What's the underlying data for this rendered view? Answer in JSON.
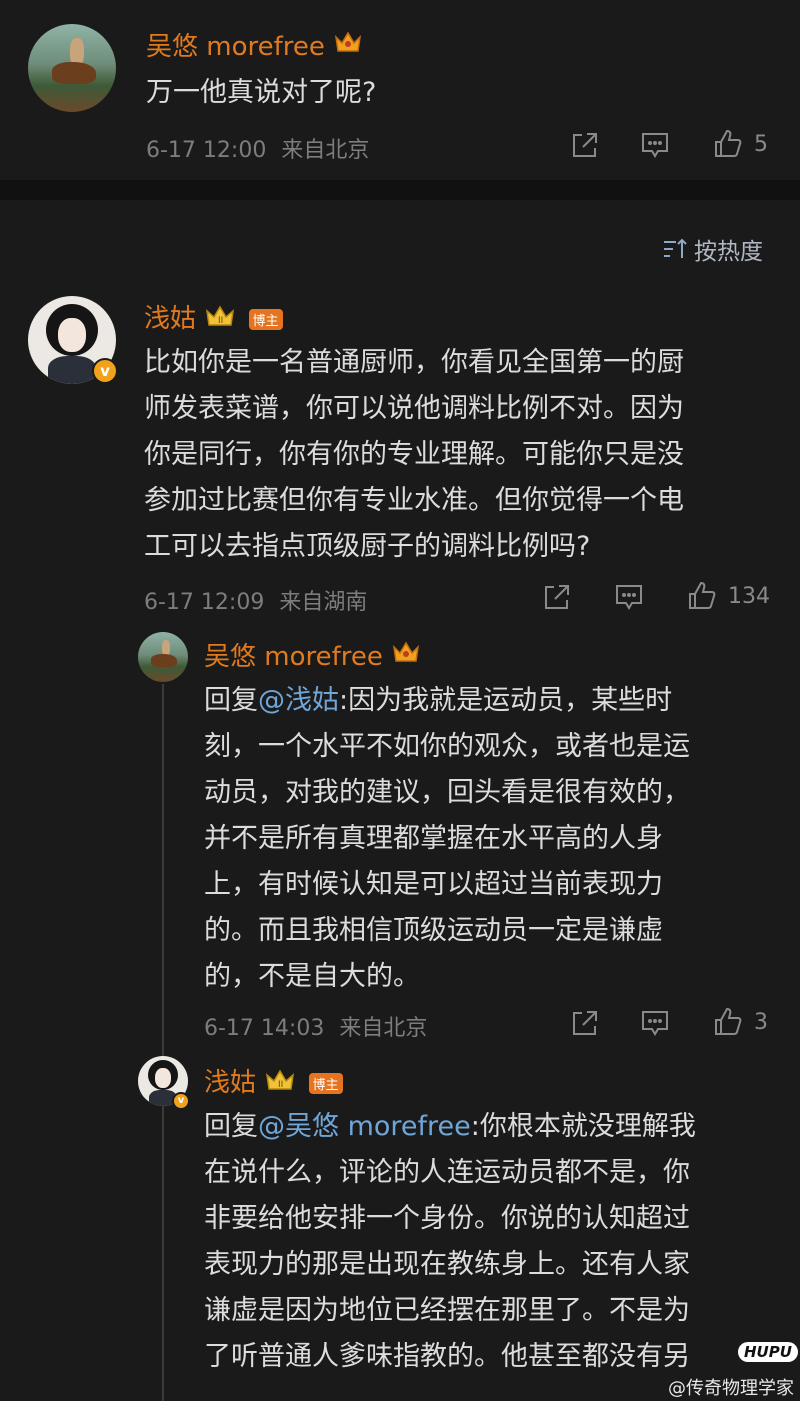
{
  "top_comment": {
    "username": "吴悠 morefree",
    "text": "万一他真说对了呢?",
    "time": "6-17 12:00",
    "location": "来自北京",
    "likes": "5"
  },
  "sort": {
    "label": "按热度"
  },
  "main_comment": {
    "username": "浅姑",
    "badge": "博主",
    "lines": [
      "比如你是一名普通厨师，你看见全国第一的厨",
      "师发表菜谱，你可以说他调料比例不对。因为",
      "你是同行，你有你的专业理解。可能你只是没",
      "参加过比赛但你有专业水准。但你觉得一个电",
      "工可以去指点顶级厨子的调料比例吗?"
    ],
    "time": "6-17 12:09",
    "location": "来自湖南",
    "likes": "134"
  },
  "reply1": {
    "username": "吴悠 morefree",
    "prefix": "回复",
    "mention": "@浅姑",
    "lines": [
      ":因为我就是运动员，某些时",
      "刻，一个水平不如你的观众，或者也是运",
      "动员，对我的建议，回头看是很有效的，",
      "并不是所有真理都掌握在水平高的人身",
      "上，有时候认知是可以超过当前表现力",
      "的。而且我相信顶级运动员一定是谦虚",
      "的，不是自大的。"
    ],
    "time": "6-17 14:03",
    "location": "来自北京",
    "likes": "3"
  },
  "reply2": {
    "username": "浅姑",
    "badge": "博主",
    "prefix": "回复",
    "mention": "@吴悠 morefree",
    "lines": [
      ":你根本就没理解我",
      "在说什么，评论的人连运动员都不是，你",
      "非要给他安排一个身份。你说的认知超过",
      "表现力的那是出现在教练身上。还有人家",
      "谦虚是因为地位已经摆在那里了。不是为",
      "了听普通人爹味指教的。他甚至都没有另"
    ]
  },
  "watermark": {
    "logo": "HUPU",
    "text": "@传奇物理学家"
  },
  "colors": {
    "background": "#1a1a1a",
    "username": "#e07a1f",
    "mention": "#6fa6d8",
    "meta": "#7d7d7d",
    "badge": "#e6731f"
  }
}
